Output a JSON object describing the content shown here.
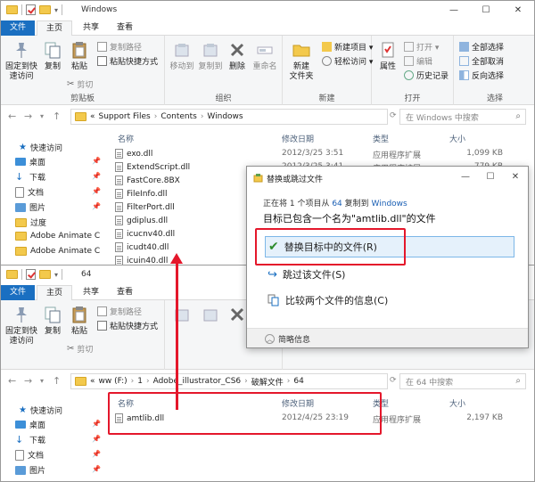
{
  "window_top": {
    "title": "Windows",
    "controls": {
      "minimize": "—",
      "maximize": "☐",
      "close": "✕"
    },
    "tabs": {
      "file": "文件",
      "home": "主页",
      "share": "共享",
      "view": "查看"
    },
    "ribbon": {
      "pin": "固定到快\n速访问",
      "copy": "复制",
      "paste": "粘贴",
      "copy_path": "复制路径",
      "paste_shortcut": "粘贴快捷方式",
      "cut": "剪切",
      "clipboard_label": "剪贴板",
      "move_to": "移动到",
      "copy_to": "复制到",
      "delete": "删除",
      "rename": "重命名",
      "organize_label": "组织",
      "new_folder": "新建\n文件夹",
      "new_item": "新建项目 ▾",
      "easy_access": "轻松访问 ▾",
      "new_label": "新建",
      "properties": "属性",
      "open": "打开 ▾",
      "edit": "编辑",
      "history": "历史记录",
      "open_label": "打开",
      "select_all": "全部选择",
      "select_none": "全部取消",
      "invert": "反向选择",
      "select_label": "选择"
    },
    "address": {
      "prefix": "«",
      "crumbs": [
        "Support Files",
        "Contents",
        "Windows"
      ],
      "search_placeholder": "在 Windows 中搜索"
    },
    "nav": [
      {
        "label": "快速访问",
        "icon": "star-icon"
      },
      {
        "label": "桌面",
        "icon": "desktop-icon"
      },
      {
        "label": "下载",
        "icon": "download-icon"
      },
      {
        "label": "文档",
        "icon": "document-icon"
      },
      {
        "label": "图片",
        "icon": "picture-icon"
      },
      {
        "label": "过度",
        "icon": "folder-icon"
      },
      {
        "label": "Adobe Animate C",
        "icon": "folder-icon"
      },
      {
        "label": "Adobe Animate C",
        "icon": "folder-icon"
      }
    ],
    "columns": {
      "name": "名称",
      "date": "修改日期",
      "type": "类型",
      "size": "大小"
    },
    "files": [
      {
        "name": "exo.dll",
        "date": "2012/3/25 3:51",
        "type": "应用程序扩展",
        "size": "1,099 KB"
      },
      {
        "name": "ExtendScript.dll",
        "date": "2012/3/25 3:41",
        "type": "应用程序扩展",
        "size": "779 KB"
      },
      {
        "name": "FastCore.8BX",
        "date": "",
        "type": "",
        "size": ""
      },
      {
        "name": "FileInfo.dll",
        "date": "",
        "type": "",
        "size": ""
      },
      {
        "name": "FilterPort.dll",
        "date": "",
        "type": "",
        "size": ""
      },
      {
        "name": "gdiplus.dll",
        "date": "",
        "type": "",
        "size": ""
      },
      {
        "name": "icucnv40.dll",
        "date": "",
        "type": "",
        "size": ""
      },
      {
        "name": "icudt40.dll",
        "date": "",
        "type": "",
        "size": ""
      },
      {
        "name": "icuin40.dll",
        "date": "",
        "type": "",
        "size": ""
      }
    ]
  },
  "window_bottom": {
    "title": "64",
    "address": {
      "prefix": "«",
      "crumbs": [
        "ww (F:)",
        "1",
        "Adobe_illustrator_CS6",
        "破解文件",
        "64"
      ],
      "search_placeholder": "在 64 中搜索"
    },
    "nav": [
      {
        "label": "快速访问",
        "icon": "star-icon"
      },
      {
        "label": "桌面",
        "icon": "desktop-icon"
      },
      {
        "label": "下载",
        "icon": "download-icon"
      },
      {
        "label": "文档",
        "icon": "document-icon"
      },
      {
        "label": "图片",
        "icon": "picture-icon"
      }
    ],
    "files": [
      {
        "name": "amtlib.dll",
        "date": "2012/4/25 23:19",
        "type": "应用程序扩展",
        "size": "2,197 KB"
      }
    ]
  },
  "dialog": {
    "title": "替换或跳过文件",
    "line1_a": "正在将 1 个项目从",
    "line1_src": "64",
    "line1_b": "复制到",
    "line1_dst": "Windows",
    "line2": "目标已包含一个名为\"amtlib.dll\"的文件",
    "opt_replace": "替换目标中的文件(R)",
    "opt_skip": "跳过该文件(S)",
    "opt_compare": "比较两个文件的信息(C)",
    "more": "简略信息"
  },
  "colors": {
    "accent": "#1a6fc1",
    "highlight": "#e4172b",
    "folder": "#f3c94c"
  }
}
